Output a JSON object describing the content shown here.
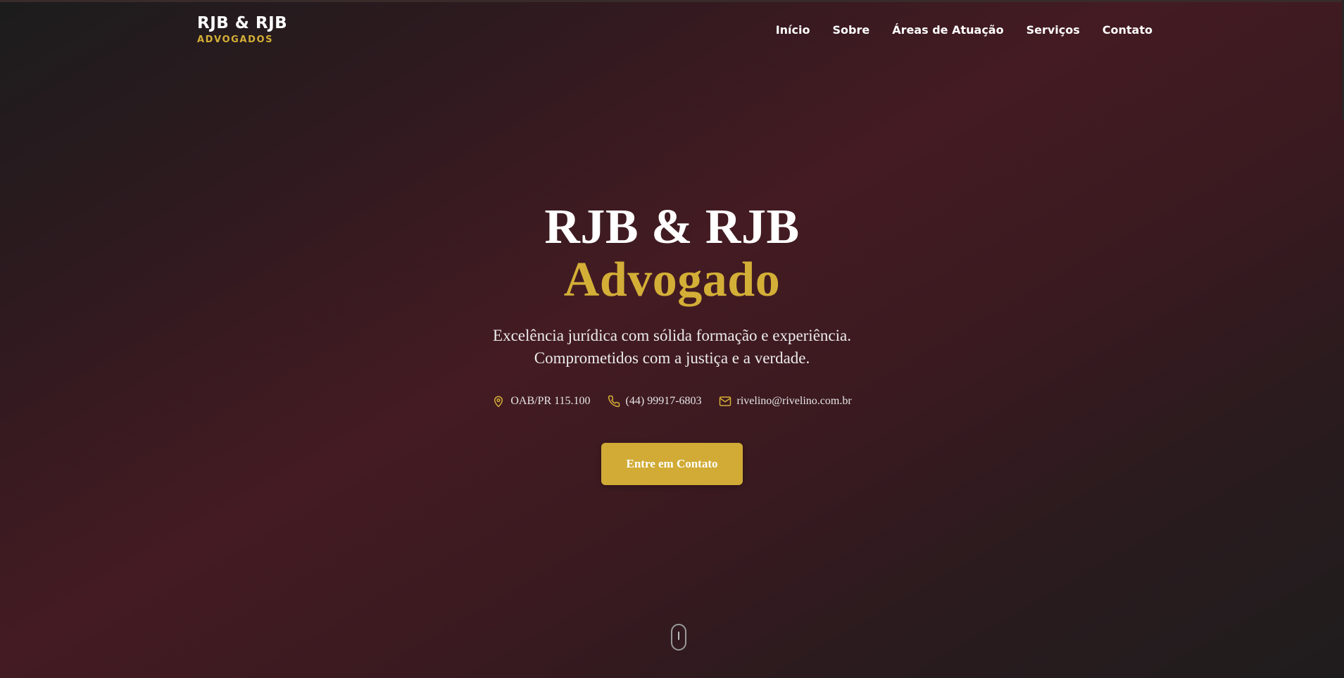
{
  "colors": {
    "accent": "#d4af37",
    "text": "#ffffff",
    "background_dark": "#1d1d1f",
    "background_wine": "#441b22"
  },
  "header": {
    "brand_name": "RJB & RJB",
    "brand_sub": "ADVOGADOS",
    "nav": [
      {
        "label": "Início"
      },
      {
        "label": "Sobre"
      },
      {
        "label": "Áreas de Atuação"
      },
      {
        "label": "Serviços"
      },
      {
        "label": "Contato"
      }
    ]
  },
  "hero": {
    "title": "RJB & RJB",
    "title_accent": "Advogado",
    "description_line1": "Excelência jurídica com sólida formação e experiência.",
    "description_line2": "Comprometidos com a justiça e a verdade.",
    "contacts": [
      {
        "icon": "map-pin-icon",
        "text": "OAB/PR 115.100"
      },
      {
        "icon": "phone-icon",
        "text": "(44) 99917-6803"
      },
      {
        "icon": "mail-icon",
        "text": "rivelino@rivelino.com.br"
      }
    ],
    "cta_label": "Entre em Contato"
  },
  "scroll_indicator": {
    "icon": "mouse-scroll-icon"
  }
}
